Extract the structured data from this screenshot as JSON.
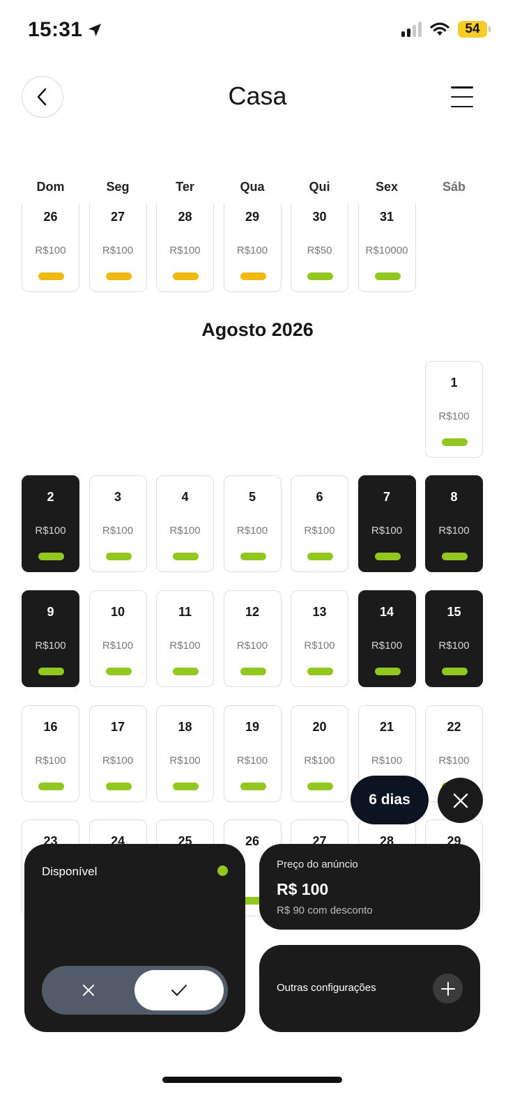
{
  "status_bar": {
    "time": "15:31",
    "battery": "54"
  },
  "header": {
    "title": "Casa"
  },
  "weekdays": [
    "Dom",
    "Seg",
    "Ter",
    "Qua",
    "Qui",
    "Sex",
    "Sáb"
  ],
  "calendar": {
    "prev_week": [
      {
        "day": "26",
        "price": "R$100",
        "status": "yellow"
      },
      {
        "day": "27",
        "price": "R$100",
        "status": "yellow"
      },
      {
        "day": "28",
        "price": "R$100",
        "status": "yellow"
      },
      {
        "day": "29",
        "price": "R$100",
        "status": "yellow"
      },
      {
        "day": "30",
        "price": "R$50",
        "status": "green"
      },
      {
        "day": "31",
        "price": "R$10000",
        "status": "green"
      }
    ],
    "month_title": "Agosto 2026",
    "month_days": [
      {
        "day": "1",
        "price": "R$100",
        "selected": false
      },
      {
        "day": "2",
        "price": "R$100",
        "selected": true
      },
      {
        "day": "3",
        "price": "R$100",
        "selected": false
      },
      {
        "day": "4",
        "price": "R$100",
        "selected": false
      },
      {
        "day": "5",
        "price": "R$100",
        "selected": false
      },
      {
        "day": "6",
        "price": "R$100",
        "selected": false
      },
      {
        "day": "7",
        "price": "R$100",
        "selected": true
      },
      {
        "day": "8",
        "price": "R$100",
        "selected": true
      },
      {
        "day": "9",
        "price": "R$100",
        "selected": true
      },
      {
        "day": "10",
        "price": "R$100",
        "selected": false
      },
      {
        "day": "11",
        "price": "R$100",
        "selected": false
      },
      {
        "day": "12",
        "price": "R$100",
        "selected": false
      },
      {
        "day": "13",
        "price": "R$100",
        "selected": false
      },
      {
        "day": "14",
        "price": "R$100",
        "selected": true
      },
      {
        "day": "15",
        "price": "R$100",
        "selected": true
      },
      {
        "day": "16",
        "price": "R$100",
        "selected": false
      },
      {
        "day": "17",
        "price": "R$100",
        "selected": false
      },
      {
        "day": "18",
        "price": "R$100",
        "selected": false
      },
      {
        "day": "19",
        "price": "R$100",
        "selected": false
      },
      {
        "day": "20",
        "price": "R$100",
        "selected": false
      },
      {
        "day": "21",
        "price": "R$100",
        "selected": false
      },
      {
        "day": "22",
        "price": "R$100",
        "selected": false
      },
      {
        "day": "23",
        "price": "",
        "selected": false
      },
      {
        "day": "24",
        "price": "",
        "selected": false
      },
      {
        "day": "25",
        "price": "",
        "selected": false
      },
      {
        "day": "26",
        "price": "",
        "selected": false
      },
      {
        "day": "27",
        "price": "",
        "selected": false
      },
      {
        "day": "28",
        "price": "",
        "selected": false
      },
      {
        "day": "29",
        "price": "",
        "selected": false
      }
    ]
  },
  "selection": {
    "days_label": "6 dias"
  },
  "availability_card": {
    "label": "Disponível"
  },
  "price_card": {
    "label": "Preço do anúncio",
    "value": "R$ 100",
    "discount": "R$ 90 com desconto"
  },
  "other_card": {
    "label": "Outras configurações"
  },
  "colors": {
    "available": "#92c71f",
    "pending": "#f0b90e",
    "selected_bg": "#1b1b1b",
    "pill_bg": "#0c1422"
  }
}
